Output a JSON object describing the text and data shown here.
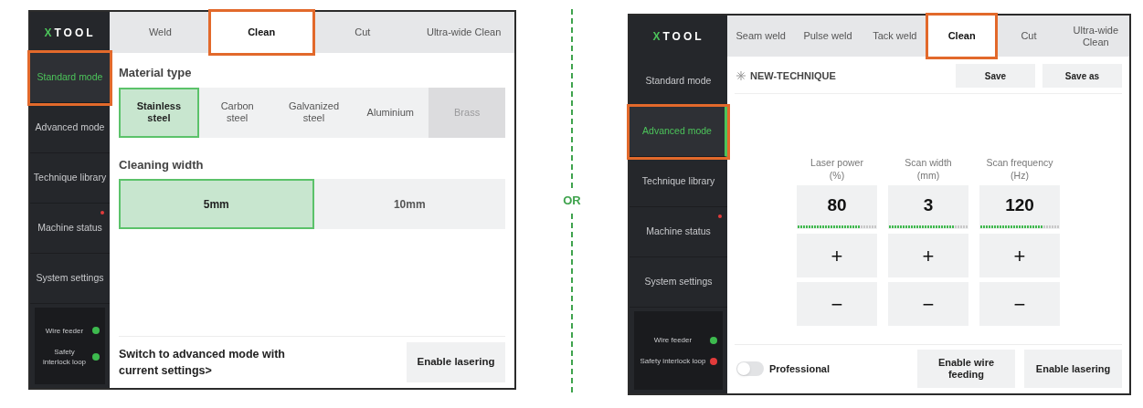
{
  "screens": [
    {
      "kind": "standard",
      "logo": "XTOOL",
      "tabs": [
        {
          "label": "Weld",
          "selected": false,
          "highlighted": false
        },
        {
          "label": "Clean",
          "selected": true,
          "highlighted": true
        },
        {
          "label": "Cut",
          "selected": false,
          "highlighted": false
        },
        {
          "label": "Ultra-wide Clean",
          "selected": false,
          "highlighted": false
        }
      ],
      "sidebar": {
        "items": [
          {
            "label": "Standard mode",
            "selected": true,
            "highlighted": true,
            "alert": false
          },
          {
            "label": "Advanced mode",
            "selected": false,
            "highlighted": false,
            "alert": false
          },
          {
            "label": "Technique library",
            "selected": false,
            "highlighted": false,
            "alert": false
          },
          {
            "label": "Machine status",
            "selected": false,
            "highlighted": false,
            "alert": true
          },
          {
            "label": "System settings",
            "selected": false,
            "highlighted": false,
            "alert": false
          }
        ],
        "status": [
          {
            "label": "Wire feeder",
            "color": "#3dba4e"
          },
          {
            "label": "Safety interlock loop",
            "color": "#3dba4e"
          }
        ]
      },
      "material_type": {
        "title": "Material type",
        "options": [
          {
            "label": "Stainless steel",
            "selected": true,
            "disabled": false
          },
          {
            "label": "Carbon steel",
            "selected": false,
            "disabled": false
          },
          {
            "label": "Galvanized steel",
            "selected": false,
            "disabled": false
          },
          {
            "label": "Aluminium",
            "selected": false,
            "disabled": false
          },
          {
            "label": "Brass",
            "selected": false,
            "disabled": true
          }
        ]
      },
      "cleaning_width": {
        "title": "Cleaning width",
        "options": [
          {
            "label": "5mm",
            "selected": true
          },
          {
            "label": "10mm",
            "selected": false
          }
        ]
      },
      "footer": {
        "link": "Switch to advanced mode with current settings>",
        "buttons": [
          "Enable lasering"
        ]
      }
    },
    {
      "kind": "advanced",
      "logo": "XTOOL",
      "tabs": [
        {
          "label": "Seam weld",
          "selected": false,
          "highlighted": false
        },
        {
          "label": "Pulse weld",
          "selected": false,
          "highlighted": false
        },
        {
          "label": "Tack weld",
          "selected": false,
          "highlighted": false
        },
        {
          "label": "Clean",
          "selected": true,
          "highlighted": true
        },
        {
          "label": "Cut",
          "selected": false,
          "highlighted": false
        },
        {
          "label": "Ultra-wide Clean",
          "selected": false,
          "highlighted": false
        }
      ],
      "sidebar": {
        "items": [
          {
            "label": "Standard mode",
            "selected": false,
            "highlighted": false,
            "alert": false
          },
          {
            "label": "Advanced mode",
            "selected": true,
            "highlighted": true,
            "alert": false
          },
          {
            "label": "Technique library",
            "selected": false,
            "highlighted": false,
            "alert": false
          },
          {
            "label": "Machine status",
            "selected": false,
            "highlighted": false,
            "alert": true
          },
          {
            "label": "System settings",
            "selected": false,
            "highlighted": false,
            "alert": false
          }
        ],
        "status": [
          {
            "label": "Wire feeder",
            "color": "#3dba4e"
          },
          {
            "label": "Safety interlock loop",
            "color": "#e23b3b"
          }
        ]
      },
      "technique": {
        "name": "NEW-TECHNIQUE",
        "actions": [
          "Save",
          "Save as"
        ]
      },
      "params": [
        {
          "label": "Laser power",
          "unit": "(%)",
          "value": "80",
          "level": 0.8,
          "plus": "+",
          "minus": "−"
        },
        {
          "label": "Scan width",
          "unit": "(mm)",
          "value": "3",
          "level": 0.82,
          "plus": "+",
          "minus": "−"
        },
        {
          "label": "Scan frequency",
          "unit": "(Hz)",
          "value": "120",
          "level": 0.8,
          "plus": "+",
          "minus": "−"
        }
      ],
      "footer": {
        "toggle": {
          "label": "Professional",
          "on": false
        },
        "buttons": [
          "Enable wire feeding",
          "Enable lasering"
        ]
      }
    }
  ],
  "separator": "OR"
}
